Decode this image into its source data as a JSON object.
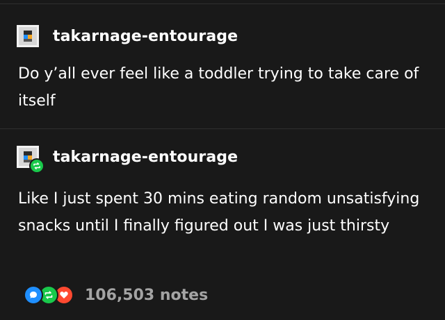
{
  "theme": {
    "background": "#191919",
    "text": "#ffffff",
    "muted_text": "#a4a4a4",
    "reblog_green": "#19c94b",
    "comment_blue": "#1f8fff",
    "like_red": "#ff4930"
  },
  "posts": [
    {
      "username": "takarnage-entourage",
      "avatar_icon": "pixel-avatar-icon",
      "text": "Do y’all ever feel like a toddler trying to take care of itself"
    },
    {
      "username": "takarnage-entourage",
      "avatar_icon": "pixel-avatar-icon",
      "badge_icon": "reblog-icon",
      "text": "Like I just spent 30 mins eating random unsatisfying snacks until I finally figured out I was just thirsty"
    }
  ],
  "footer": {
    "icons": [
      "comment-icon",
      "reblog-icon",
      "heart-icon"
    ],
    "notes": "106,503 notes"
  }
}
